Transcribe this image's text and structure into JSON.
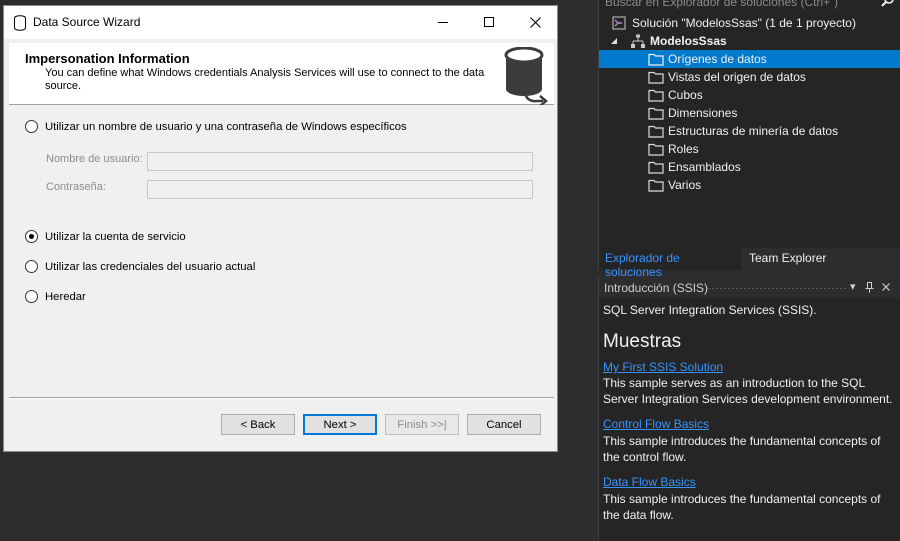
{
  "wizard": {
    "title": "Data Source Wizard",
    "header_title": "Impersonation Information",
    "header_desc": "You can define what Windows credentials Analysis Services will use to connect to the data source.",
    "options": [
      {
        "label": "Utilizar un nombre de usuario y una contraseña de Windows específicos",
        "checked": false
      },
      {
        "label": "Utilizar la cuenta de servicio",
        "checked": true
      },
      {
        "label": "Utilizar las credenciales del usuario actual",
        "checked": false
      },
      {
        "label": "Heredar",
        "checked": false
      }
    ],
    "username_label": "Nombre de usuario:",
    "password_label": "Contraseña:",
    "username_value": "",
    "password_value": "",
    "buttons": {
      "back": "< Back",
      "next": "Next >",
      "finish": "Finish >>|",
      "cancel": "Cancel"
    }
  },
  "solution_explorer": {
    "search_placeholder": "Buscar en Explorador de soluciones (Ctrl+´)",
    "solution_label": "Solución \"ModelosSsas\" (1 de 1 proyecto)",
    "project_label": "ModelosSsas",
    "items": [
      {
        "label": "Orígenes de datos",
        "selected": true
      },
      {
        "label": "Vistas del origen de datos",
        "selected": false
      },
      {
        "label": "Cubos",
        "selected": false
      },
      {
        "label": "Dimensiones",
        "selected": false
      },
      {
        "label": "Estructuras de minería de datos",
        "selected": false
      },
      {
        "label": "Roles",
        "selected": false
      },
      {
        "label": "Ensamblados",
        "selected": false
      },
      {
        "label": "Varios",
        "selected": false
      }
    ],
    "tabs": [
      "Explorador de soluciones",
      "Team Explorer"
    ]
  },
  "intro_panel": {
    "title": "Introducción (SSIS)",
    "subtitle": "SQL Server Integration Services (SSIS).",
    "heading": "Muestras",
    "samples": [
      {
        "link": "My First SSIS Solution",
        "desc": "This sample serves as an introduction to the SQL Server Integration Services development environment."
      },
      {
        "link": "Control Flow Basics",
        "desc": "This sample introduces the fundamental concepts of the control flow."
      },
      {
        "link": "Data Flow Basics",
        "desc": "This sample introduces the fundamental concepts of the data flow."
      }
    ]
  },
  "colors": {
    "accent": "#007acc",
    "link": "#3794ff",
    "ide_background": "#2d2d30",
    "dialog_background": "#f0f0f0"
  },
  "icons": [
    "database-icon",
    "minimize-icon",
    "maximize-icon",
    "close-icon",
    "search-icon",
    "solution-icon",
    "project-icon",
    "folder-icon",
    "pin-icon"
  ]
}
